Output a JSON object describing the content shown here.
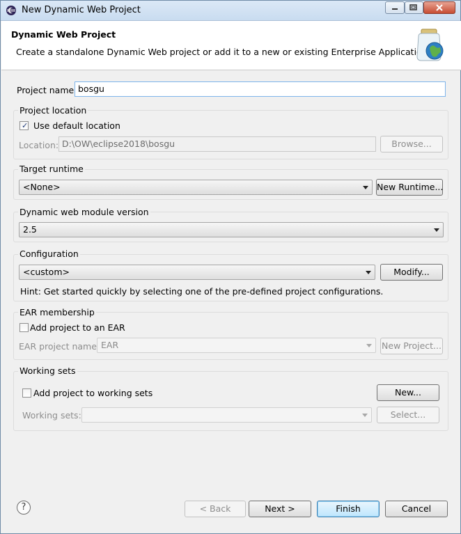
{
  "window": {
    "title": "New Dynamic Web Project"
  },
  "banner": {
    "title": "Dynamic Web Project",
    "description": "Create a standalone Dynamic Web project or add it to a new or existing Enterprise Application."
  },
  "project_name": {
    "label": "Project name:",
    "value": "bosgu"
  },
  "project_location": {
    "group_label": "Project location",
    "use_default_label": "Use default location",
    "use_default_checked": true,
    "location_label": "Location:",
    "location_value": "D:\\OW\\eclipse2018\\bosgu",
    "browse_label": "Browse..."
  },
  "target_runtime": {
    "group_label": "Target runtime",
    "selected": "<None>",
    "new_runtime_label": "New Runtime..."
  },
  "module_version": {
    "group_label": "Dynamic web module version",
    "selected": "2.5"
  },
  "configuration": {
    "group_label": "Configuration",
    "selected": "<custom>",
    "modify_label": "Modify...",
    "hint": "Hint: Get started quickly by selecting one of the pre-defined project configurations."
  },
  "ear_membership": {
    "group_label": "EAR membership",
    "add_label": "Add project to an EAR",
    "add_checked": false,
    "ear_name_label": "EAR project name:",
    "ear_name_value": "EAR",
    "new_project_label": "New Project..."
  },
  "working_sets": {
    "group_label": "Working sets",
    "add_label": "Add project to working sets",
    "add_checked": false,
    "new_label": "New...",
    "sets_label": "Working sets:",
    "sets_value": "",
    "select_label": "Select..."
  },
  "footer": {
    "help_icon_glyph": "?",
    "back_label": "< Back",
    "next_label": "Next >",
    "finish_label": "Finish",
    "cancel_label": "Cancel"
  },
  "icons": {
    "app": "eclipse-icon",
    "banner": "web-project-jar-icon",
    "minimize": "minimize-icon",
    "maximize": "maximize-icon",
    "close": "close-icon"
  }
}
